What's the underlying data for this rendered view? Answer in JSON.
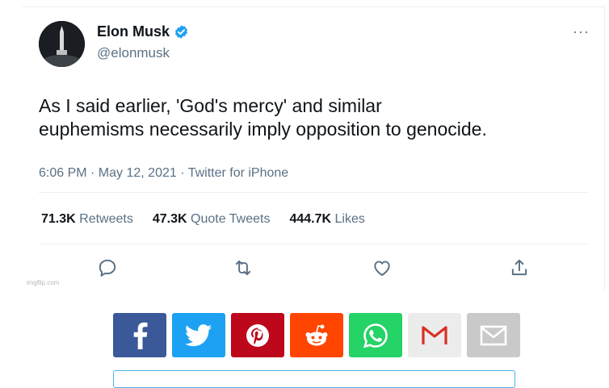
{
  "tweet": {
    "author_name": "Elon Musk",
    "author_handle": "@elonmusk",
    "text_line1": "As I said earlier, 'God's mercy' and similar",
    "text_line2": "euphemisms necessarily imply opposition to genocide.",
    "timestamp": "6:06 PM · May 12, 2021 · Twitter for iPhone",
    "stats": {
      "retweets_count": "71.3K",
      "retweets_label": "Retweets",
      "quote_count": "47.3K",
      "quote_label": "Quote Tweets",
      "likes_count": "444.7K",
      "likes_label": "Likes"
    },
    "more_label": "···"
  },
  "watermark": "imgflip.com",
  "actions": [
    "reply-icon",
    "retweet-icon",
    "like-icon",
    "share-icon"
  ],
  "share_buttons": [
    {
      "name": "facebook",
      "color": "#3b5998"
    },
    {
      "name": "twitter",
      "color": "#1da1f2"
    },
    {
      "name": "pinterest",
      "color": "#bd081c"
    },
    {
      "name": "reddit",
      "color": "#ff4500"
    },
    {
      "name": "whatsapp",
      "color": "#25d366"
    },
    {
      "name": "gmail",
      "color": "#ececec"
    },
    {
      "name": "email",
      "color": "#c9c9c9"
    }
  ],
  "colors": {
    "verified": "#1da1f2",
    "secondary_text": "#5b7083",
    "divider": "#ebeef0"
  }
}
